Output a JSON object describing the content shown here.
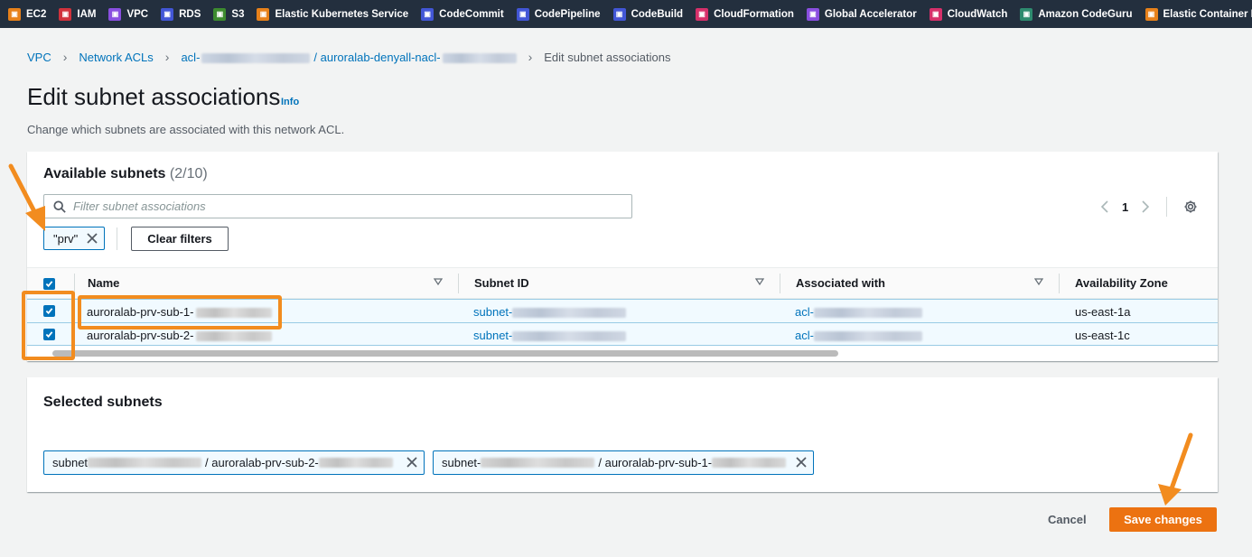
{
  "services": [
    {
      "label": "EC2",
      "color": "#e7811a",
      "icon": "ec2-icon"
    },
    {
      "label": "IAM",
      "color": "#d1323c",
      "icon": "iam-icon"
    },
    {
      "label": "VPC",
      "color": "#8a4fe0",
      "icon": "vpc-icon"
    },
    {
      "label": "RDS",
      "color": "#4256d6",
      "icon": "rds-icon"
    },
    {
      "label": "S3",
      "color": "#3d8b2f",
      "icon": "s3-icon"
    },
    {
      "label": "Elastic Kubernetes Service",
      "color": "#e7811a",
      "icon": "eks-icon"
    },
    {
      "label": "CodeCommit",
      "color": "#4256d6",
      "icon": "codecommit-icon"
    },
    {
      "label": "CodePipeline",
      "color": "#4256d6",
      "icon": "codepipeline-icon"
    },
    {
      "label": "CodeBuild",
      "color": "#4256d6",
      "icon": "codebuild-icon"
    },
    {
      "label": "CloudFormation",
      "color": "#d6306a",
      "icon": "cloudformation-icon"
    },
    {
      "label": "Global Accelerator",
      "color": "#8a4fe0",
      "icon": "global-accelerator-icon"
    },
    {
      "label": "CloudWatch",
      "color": "#d6306a",
      "icon": "cloudwatch-icon"
    },
    {
      "label": "Amazon CodeGuru",
      "color": "#2e8b6f",
      "icon": "codeguru-icon"
    },
    {
      "label": "Elastic Container Registry",
      "color": "#e7811a",
      "icon": "ecr-icon"
    }
  ],
  "breadcrumb": {
    "vpc": "VPC",
    "nacls": "Network ACLs",
    "acl_prefix": "acl-",
    "nacl_name": "/ auroralab-denyall-nacl-",
    "current": "Edit subnet associations"
  },
  "page": {
    "title": "Edit subnet associations",
    "info": "Info",
    "description": "Change which subnets are associated with this network ACL."
  },
  "available": {
    "title": "Available subnets",
    "count": "(2/10)",
    "filter_placeholder": "Filter subnet associations",
    "page_number": "1",
    "token": "\"prv\"",
    "clear_filters": "Clear filters",
    "columns": [
      "Name",
      "Subnet ID",
      "Associated with",
      "Availability Zone"
    ],
    "rows": [
      {
        "name": "auroralab-prv-sub-1-",
        "subnet": "subnet-",
        "acl": "acl-",
        "az": "us-east-1a"
      },
      {
        "name": "auroralab-prv-sub-2-",
        "subnet": "subnet-",
        "acl": "acl-",
        "az": "us-east-1c"
      }
    ]
  },
  "selected": {
    "title": "Selected subnets",
    "tokens": [
      {
        "prefix": "subnet",
        "name": "/ auroralab-prv-sub-2-"
      },
      {
        "prefix": "subnet-",
        "name": "/ auroralab-prv-sub-1-"
      }
    ]
  },
  "actions": {
    "cancel": "Cancel",
    "save": "Save changes"
  },
  "colors": {
    "accent": "#0073bb",
    "highlight": "#f28c1f",
    "primary_button": "#ec7211",
    "topbar": "#232f3e"
  }
}
